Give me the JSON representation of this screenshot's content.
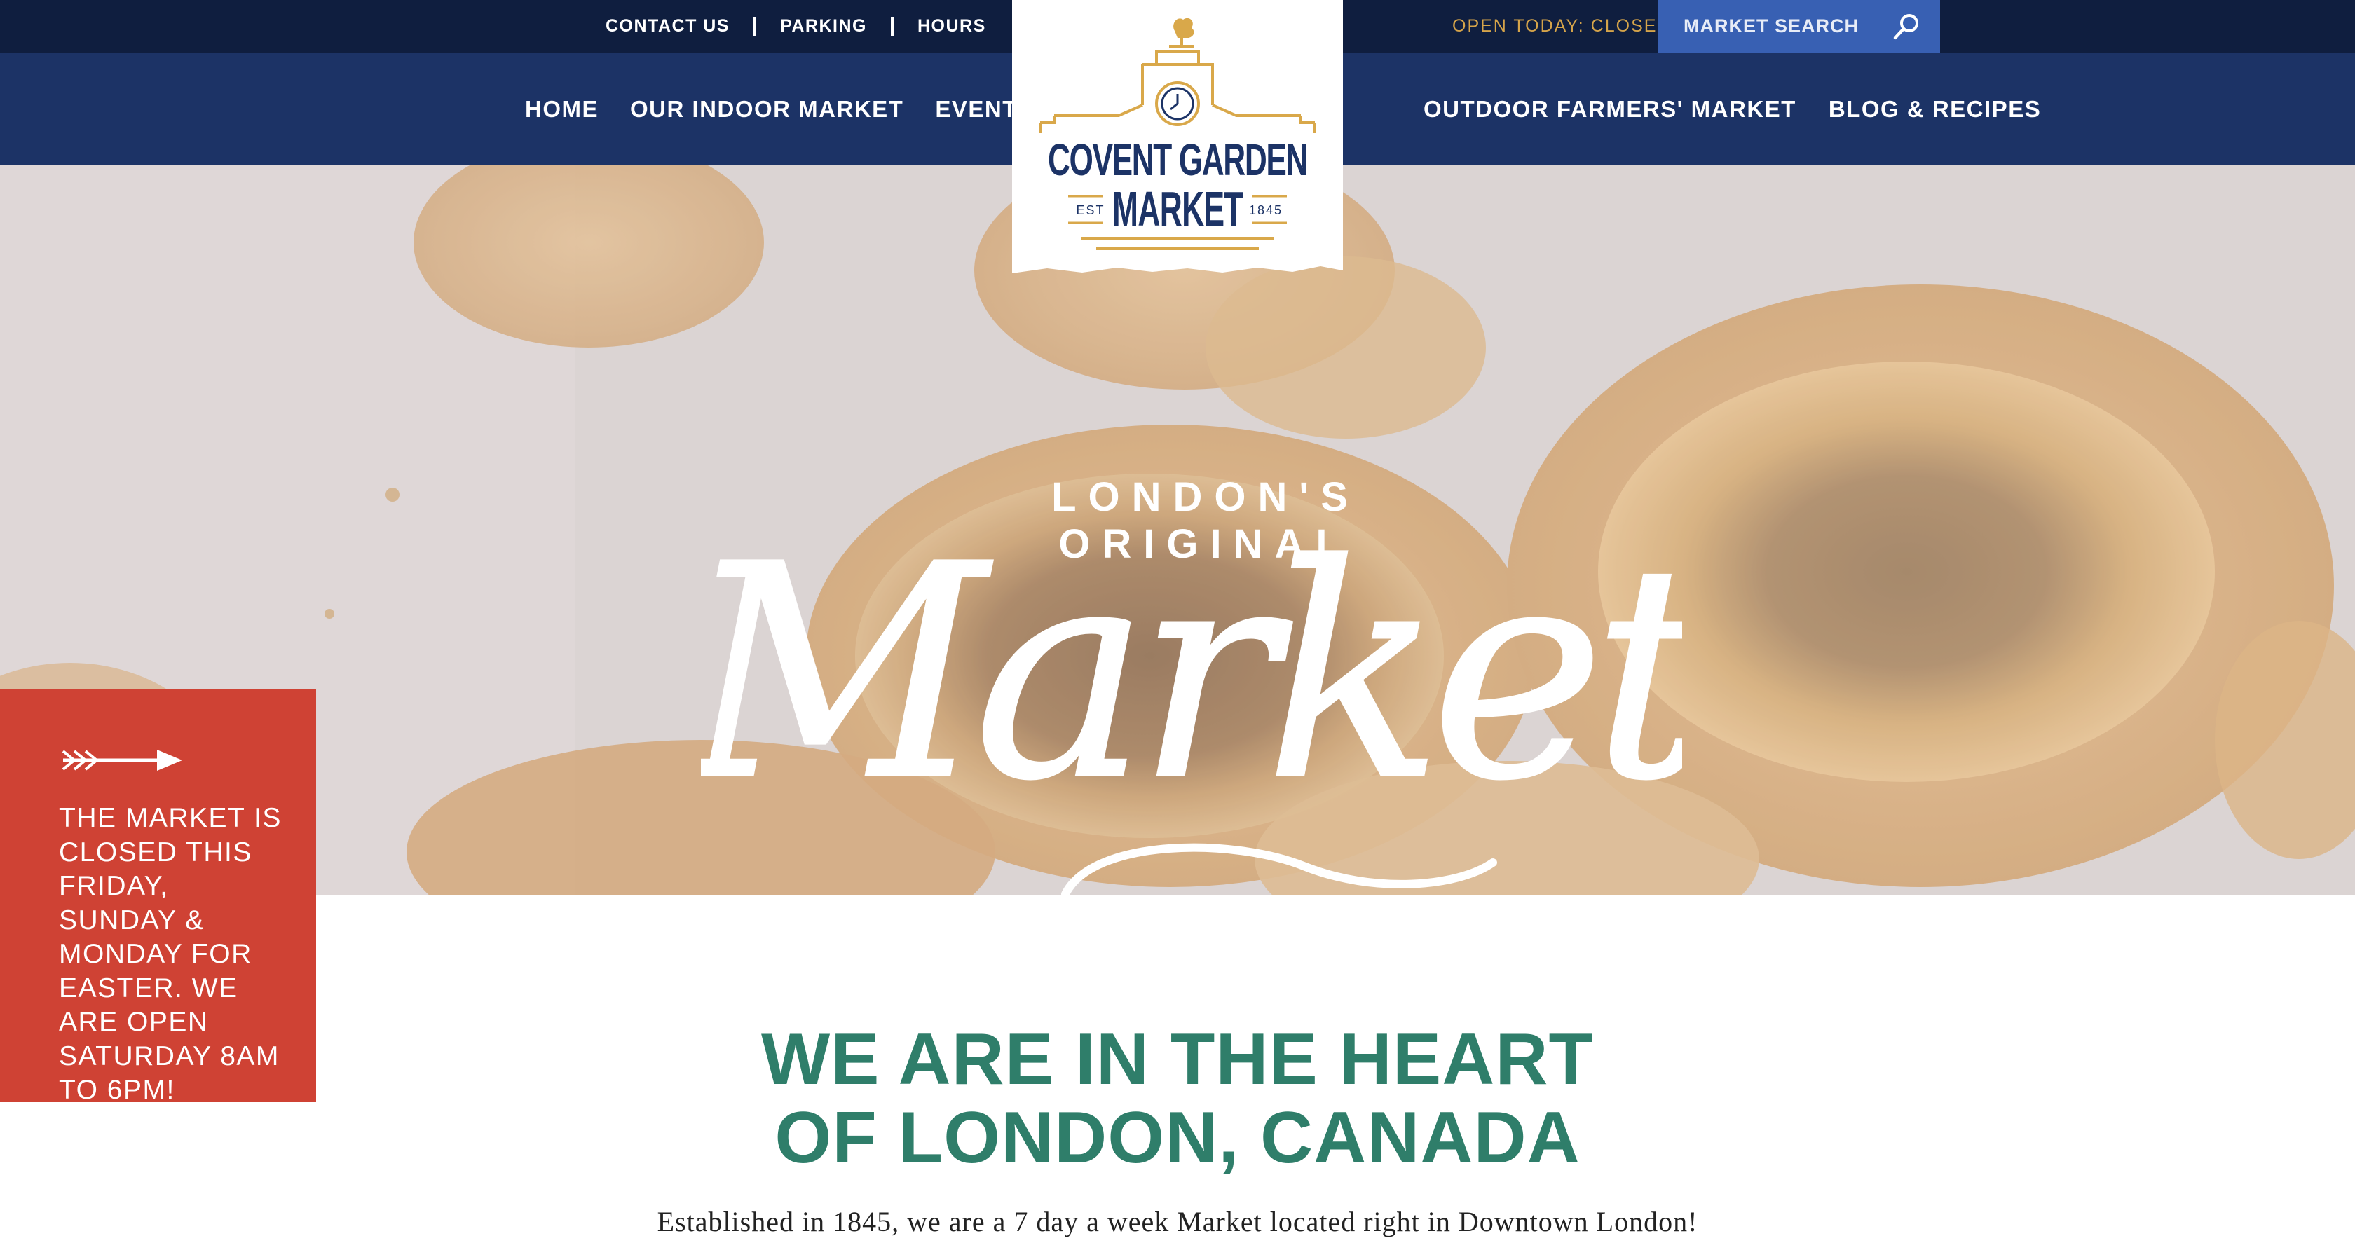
{
  "utility_links": [
    "CONTACT US",
    "PARKING",
    "HOURS"
  ],
  "open_status": "OPEN TODAY: CLOSED",
  "search": {
    "placeholder": "MARKET SEARCH"
  },
  "nav_left": [
    "HOME",
    "OUR INDOOR MARKET",
    "EVENTS"
  ],
  "nav_right": [
    "OUTDOOR FARMERS' MARKET",
    "BLOG & RECIPES"
  ],
  "logo": {
    "line1": "COVENT GARDEN",
    "line2": "MARKET",
    "est": "EST",
    "year": "1845"
  },
  "hero": {
    "tagline": "LONDON'S ORIGINAL",
    "script_word": "Market"
  },
  "notice": {
    "text": "THE MARKET IS CLOSED THIS FRIDAY, SUNDAY & MONDAY FOR EASTER. WE ARE OPEN SATURDAY 8AM TO 6PM!"
  },
  "intro": {
    "heading": "WE ARE IN THE HEART OF LONDON, CANADA",
    "text": "Established in 1845, we are a 7 day a week Market located right in Downtown London!"
  },
  "colors": {
    "utility_bar": "#0f1e3f",
    "nav_bar": "#1c3366",
    "search_bg": "#3860b3",
    "open_status": "#d5a44a",
    "notice_bg": "#cf4234",
    "heading_green": "#2f7e6a"
  },
  "icons": [
    "search-icon",
    "arrow-right-icon",
    "clock-icon",
    "rooster-icon"
  ]
}
